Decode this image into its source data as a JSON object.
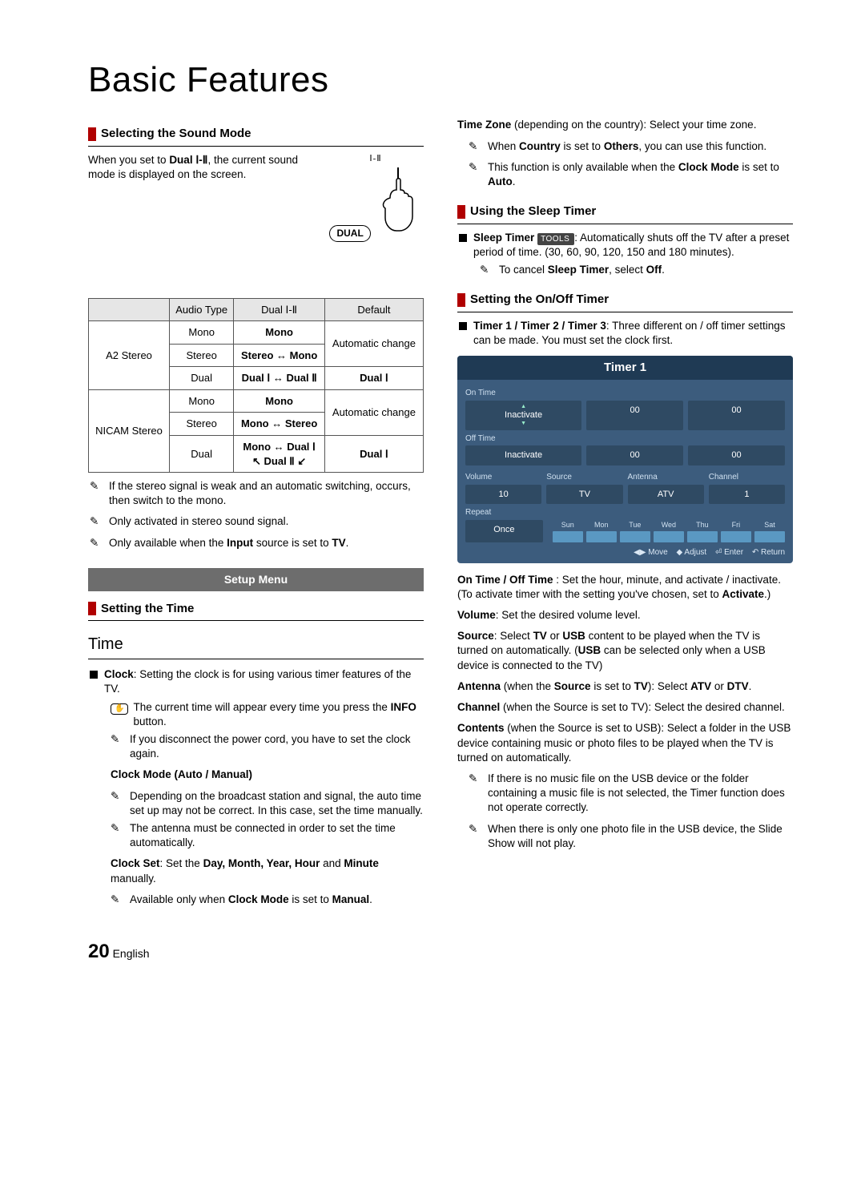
{
  "page_title": "Basic Features",
  "footer": {
    "page_number": "20",
    "lang": "English"
  },
  "sound": {
    "heading": "Selecting the Sound Mode",
    "intro_pre": "When you set to ",
    "intro_bold": "Dual Ⅰ-Ⅱ",
    "intro_post": ", the current sound mode is displayed on the screen.",
    "btn_top": "Ⅰ-Ⅱ",
    "btn_label": "DUAL",
    "table": {
      "h1": "Audio Type",
      "h2": "Dual Ⅰ-Ⅱ",
      "h3": "Default",
      "a2_label": "A2 Stereo",
      "a2_rows": [
        {
          "t": "Mono",
          "d": "Mono",
          "def": "Automatic change"
        },
        {
          "t": "Stereo",
          "d": "Stereo ↔ Mono",
          "def": ""
        },
        {
          "t": "Dual",
          "d": "Dual Ⅰ ↔ Dual Ⅱ",
          "def": "Dual Ⅰ"
        }
      ],
      "nicam_label": "NICAM Stereo",
      "nicam_rows": [
        {
          "t": "Mono",
          "d": "Mono",
          "def": "Automatic change"
        },
        {
          "t": "Stereo",
          "d": "Mono ↔ Stereo",
          "def": ""
        },
        {
          "t": "Dual",
          "d": "Mono ↔ Dual Ⅰ\n↖ Dual Ⅱ ↙",
          "def": "Dual Ⅰ"
        }
      ]
    },
    "notes": [
      "If the stereo signal is weak and an automatic switching, occurs, then switch to the mono.",
      "Only activated in stereo sound signal.",
      "Only available when the Input source is set to TV."
    ],
    "note3_bold": "Input",
    "note3_tail": "TV"
  },
  "setup_band": "Setup Menu",
  "time": {
    "heading": "Setting the Time",
    "big": "Time",
    "clock_label": "Clock",
    "clock_desc": ": Setting the clock is for using various timer features of the TV.",
    "info_note_pre": "The current time will appear every time you press the ",
    "info_note_bold": "INFO",
    "info_note_post": " button.",
    "disconnect_note": "If you disconnect the power cord, you have to set the clock again.",
    "clock_mode_label": "Clock Mode (Auto / Manual)",
    "cm_note1": "Depending on the broadcast station and signal, the auto time set up may not be correct. In this case, set the time manually.",
    "cm_note2": "The antenna must be connected in order to set the time automatically.",
    "clock_set_pre": "Clock Set",
    "clock_set_mid": ": Set the ",
    "clock_set_items": "Day, Month, Year, Hour",
    "clock_set_and": " and ",
    "clock_set_last": "Minute",
    "clock_set_tail": " manually.",
    "cs_note_pre": "Available only when ",
    "cs_note_bold": "Clock Mode",
    "cs_note_mid": " is set to ",
    "cs_note_bold2": "Manual",
    "cs_note_end": "."
  },
  "tz": {
    "lead_bold": "Time Zone",
    "lead_rest": " (depending on the country): Select your time zone.",
    "note1_pre": "When ",
    "note1_b1": "Country",
    "note1_mid": " is set to ",
    "note1_b2": "Others",
    "note1_end": ", you can use this function.",
    "note2_pre": "This function is only available when the ",
    "note2_b1": "Clock Mode",
    "note2_mid": " is set to ",
    "note2_b2": "Auto",
    "note2_end": "."
  },
  "sleep": {
    "heading": "Using the Sleep Timer",
    "label": "Sleep Timer",
    "badge": "TOOLS",
    "desc": ": Automatically shuts off the TV after a preset period of time. (30, 60, 90, 120, 150 and 180 minutes).",
    "note_pre": "To cancel ",
    "note_b1": "Sleep Timer",
    "note_mid": ", select ",
    "note_b2": "Off",
    "note_end": "."
  },
  "onoff": {
    "heading": "Setting the On/Off Timer",
    "lead_bold": "Timer 1 / Timer 2 / Timer 3",
    "lead_rest": ": Three different on / off timer settings can be made. You must set the clock first.",
    "osd": {
      "title": "Timer 1",
      "on_time": "On Time",
      "off_time": "Off Time",
      "inactivate": "Inactivate",
      "zero": "00",
      "volume": "Volume",
      "source": "Source",
      "antenna": "Antenna",
      "channel": "Channel",
      "v_volume": "10",
      "v_source": "TV",
      "v_antenna": "ATV",
      "v_channel": "1",
      "repeat": "Repeat",
      "once": "Once",
      "days": [
        "Sun",
        "Mon",
        "Tue",
        "Wed",
        "Thu",
        "Fri",
        "Sat"
      ],
      "foot_move": "◀▶ Move",
      "foot_adjust": "◆ Adjust",
      "foot_enter": "⏎ Enter",
      "foot_return": "↶ Return"
    },
    "p_onoff_b": "On Time / Off Time",
    "p_onoff": "  : Set the hour, minute, and activate / inactivate. (To activate timer with the setting you've chosen, set to ",
    "p_onoff_b2": "Activate",
    "p_onoff_end": ".)",
    "p_vol_b": "Volume",
    "p_vol": ": Set the desired volume level.",
    "p_src_b": "Source",
    "p_src": ": Select TV or USB content to be played when the TV is turned on automatically. (USB can be selected only when a USB device is connected to the TV)",
    "p_src_b2": "TV",
    "p_src_b3": "USB",
    "p_src_b4": "USB",
    "p_ant_b": "Antenna",
    "p_ant_mid": " (when the ",
    "p_ant_b2": "Source",
    "p_ant_mid2": " is set to ",
    "p_ant_b3": "TV",
    "p_ant_rest": "): Select ",
    "p_ant_b4": "ATV",
    "p_ant_or": " or ",
    "p_ant_b5": "DTV",
    "p_ant_end": ".",
    "p_ch_b": "Channel",
    "p_ch_rest": " (when the Source is set to TV): Select the desired channel.",
    "p_ct_b": "Contents",
    "p_ct_rest": " (when the Source is set to USB): Select a folder in the USB device containing music or photo files to be played when the TV is turned on automatically.",
    "note1": "If there is no music file on the USB device or the folder containing a music file is not selected, the Timer function does not operate correctly.",
    "note2": "When there is only one photo file in the USB device, the Slide Show will not play."
  }
}
